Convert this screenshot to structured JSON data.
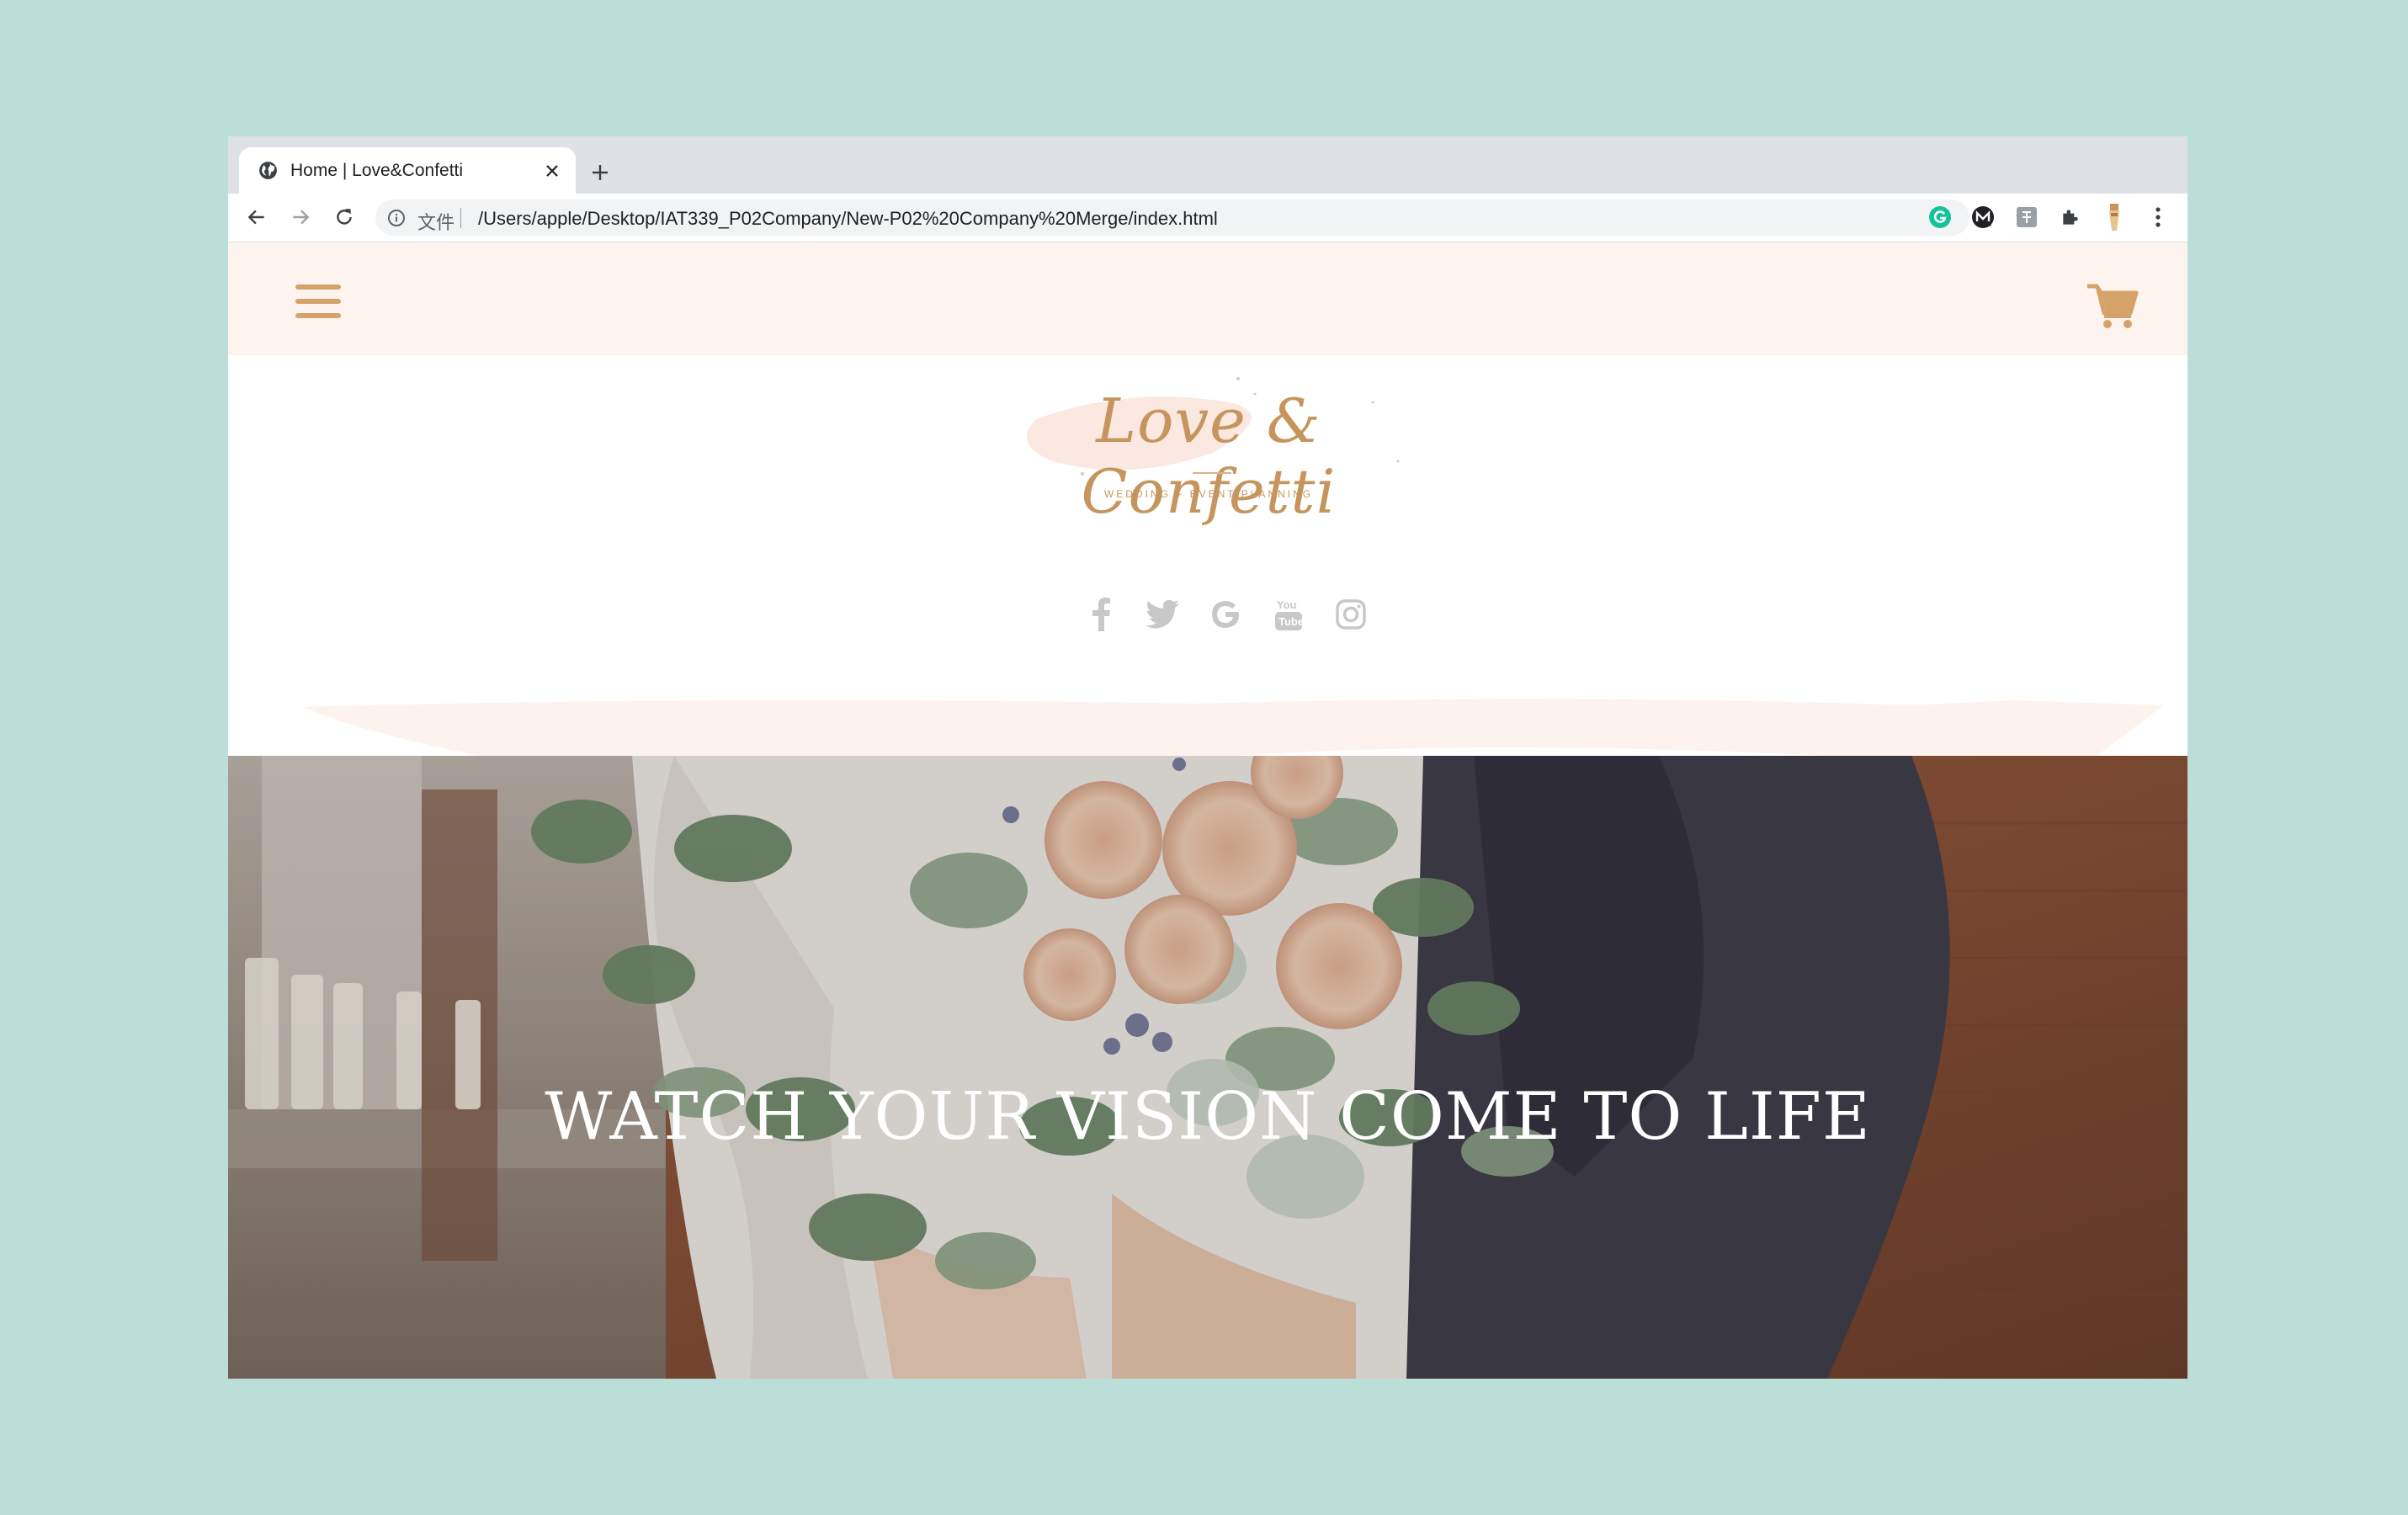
{
  "browser": {
    "tab_title": "Home | Love&Confetti",
    "omnibox_scheme_label": "文件",
    "url": "/Users/apple/Desktop/IAT339_P02Company/New-P02%20Company%20Merge/index.html"
  },
  "site": {
    "logo": {
      "name": "Love & Confetti",
      "tagline": "WEDDING + EVENT PLANNING"
    },
    "social_icons": [
      "facebook-icon",
      "twitter-icon",
      "google-icon",
      "youtube-icon",
      "instagram-icon"
    ],
    "hero": {
      "headline": "WATCH YOUR VISION COME TO LIFE"
    }
  },
  "colors": {
    "page_background": "#bbdfd8",
    "nav_background": "#fdf4ef",
    "accent_gold": "#d5a36a",
    "social_gray": "#c8c8c8"
  }
}
